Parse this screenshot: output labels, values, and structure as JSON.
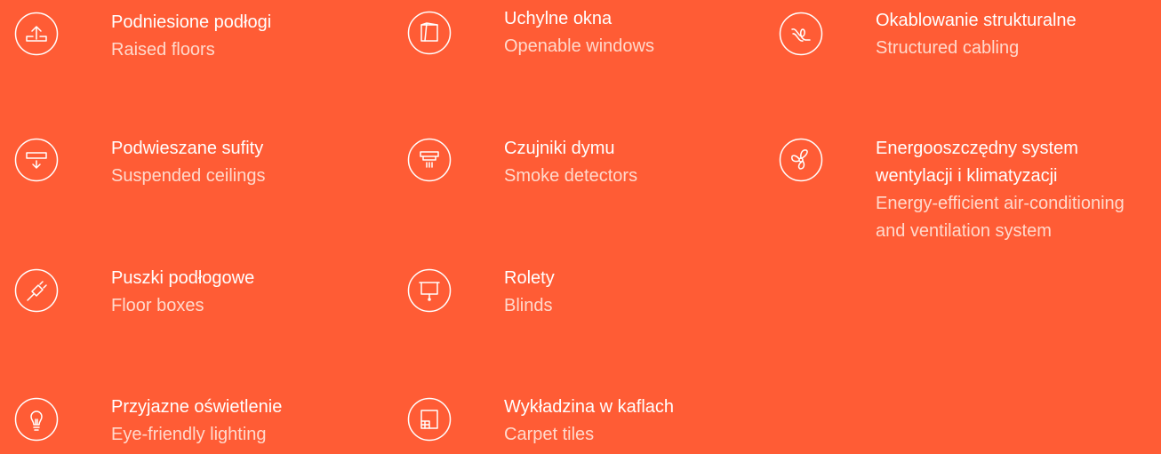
{
  "colors": {
    "background": "#FF5C35",
    "primary_text": "#FFFFFF",
    "secondary_text": "#FFD9CC"
  },
  "features": [
    {
      "icon": "raised-floor-icon",
      "pl": "Podniesione podłogi",
      "en": "Raised floors"
    },
    {
      "icon": "openable-window-icon",
      "pl": "Uchylne okna",
      "en": "Openable windows"
    },
    {
      "icon": "cable-icon",
      "pl": "Okablowanie strukturalne",
      "en": "Structured cabling"
    },
    {
      "icon": "suspended-ceiling-icon",
      "pl": "Podwieszane sufity",
      "en": "Suspended ceilings"
    },
    {
      "icon": "smoke-detector-icon",
      "pl": "Czujniki dymu",
      "en": "Smoke detectors"
    },
    {
      "icon": "fan-icon",
      "pl": "Energooszczędny system",
      "pl2": "wentylacji i klimatyzacji",
      "en": "Energy-efficient air-conditioning",
      "en2": "and ventilation system"
    },
    {
      "icon": "plug-icon",
      "pl": "Puszki podłogowe",
      "en": "Floor boxes"
    },
    {
      "icon": "blinds-icon",
      "pl": "Rolety",
      "en": "Blinds"
    },
    {
      "icon": "lightbulb-icon",
      "pl": "Przyjazne oświetlenie",
      "en": "Eye-friendly lighting"
    },
    {
      "icon": "carpet-tiles-icon",
      "pl": "Wykładzina w kaflach",
      "en": "Carpet tiles"
    }
  ]
}
